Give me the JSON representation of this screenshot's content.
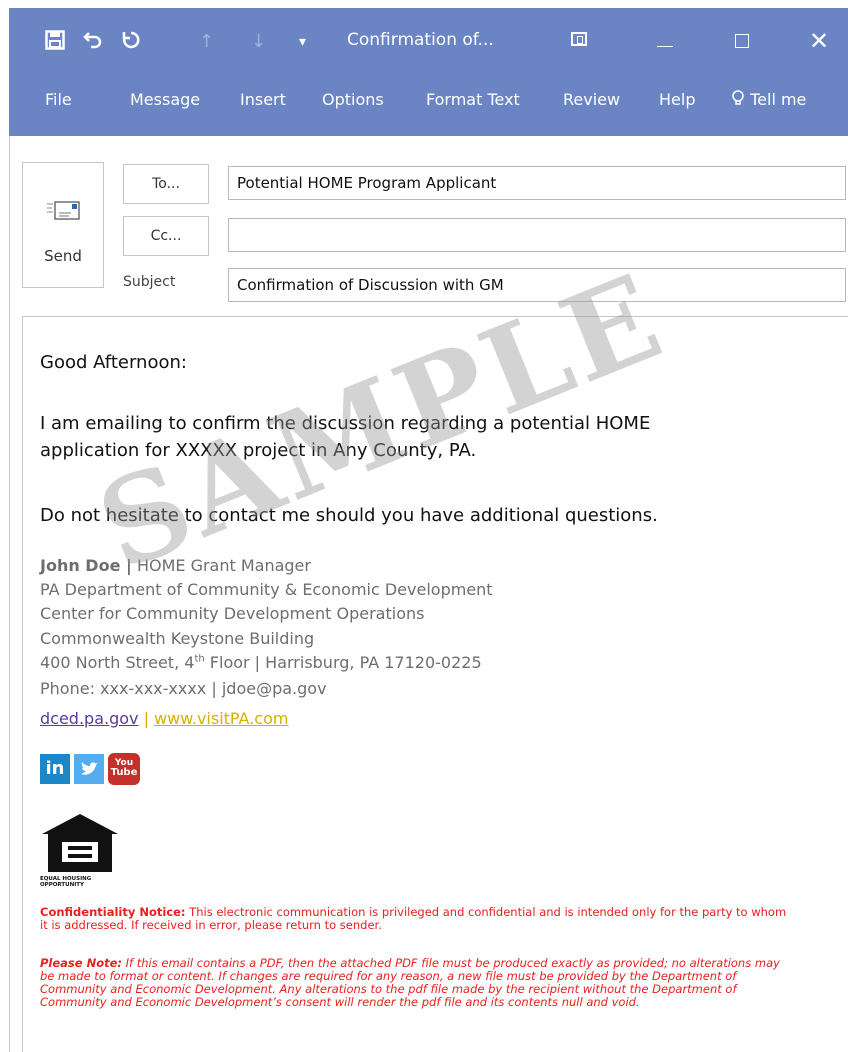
{
  "window": {
    "title": "Confirmation of...",
    "icons": {
      "save": "save-icon",
      "undo": "undo-icon",
      "redo": "redo-icon",
      "up": "up-arrow-icon",
      "down": "down-arrow-icon",
      "customize": "customize-icon",
      "ribbon": "ribbon-display-icon",
      "minimize": "minimize-icon",
      "maximize": "maximize-icon",
      "close": "close-icon"
    }
  },
  "menu": {
    "file": "File",
    "message": "Message",
    "insert": "Insert",
    "options": "Options",
    "format_text": "Format Text",
    "review": "Review",
    "help": "Help",
    "tell_me": "Tell me"
  },
  "header": {
    "send_label": "Send",
    "to_button": "To...",
    "cc_button": "Cc...",
    "subject_label": "Subject",
    "to_value": "Potential HOME Program Applicant",
    "cc_value": "",
    "subject_value": "Confirmation of Discussion with GM"
  },
  "body": {
    "greeting": "Good Afternoon:",
    "para1_line1": "I am emailing to confirm the discussion regarding a potential HOME",
    "para1_line2": "application for XXXXX project in Any County, PA.",
    "para2": "Do not hesitate to contact me should you have additional questions.",
    "watermark": "SAMPLE"
  },
  "signature": {
    "name": "John Doe |",
    "title": "HOME Grant Manager",
    "org": "PA Department of Community & Economic Development",
    "center": "Center for Community Development Operations",
    "building": "Commonwealth Keystone Building",
    "address_pre": "400 North Street, 4",
    "address_sup": "th",
    "address_post": " Floor | Harrisburg, PA 17120-0225",
    "phone": "Phone: xxx-xxx-xxxx | jdoe@pa.gov",
    "link_dced": "dced.pa.gov",
    "link_sep": " | ",
    "link_visit": "www.visitPA.com",
    "social": {
      "linkedin": "in",
      "youtube_top": "You",
      "youtube_bottom": "Tube"
    },
    "eho_line1": "EQUAL HOUSING",
    "eho_line2": "OPPORTUNITY"
  },
  "notices": {
    "confidentiality_label": "Confidentiality Notice:",
    "confidentiality_text": " This electronic communication is privileged and confidential and is intended only for the party to whom it is addressed. If received in error, please return to sender.",
    "please_note_label": "Please Note:",
    "please_note_text": " If this email contains a PDF, then the attached PDF file must be produced exactly as provided; no alterations may be made to format or content. If changes are required for any reason, a new file must be provided by the Department of Community and Economic Development. Any alterations to the pdf file made by the recipient without the Department of Community and Economic Development’s consent will render the pdf file and its contents null and void."
  },
  "colors": {
    "titlebar": "#6b85c4",
    "signature_text": "#6e6e6e",
    "link_purple": "#5a3a9e",
    "link_yellow": "#d9b000",
    "notice_red": "#e8201e",
    "linkedin": "#1c86c6",
    "twitter": "#55acee",
    "youtube": "#c4302b"
  }
}
